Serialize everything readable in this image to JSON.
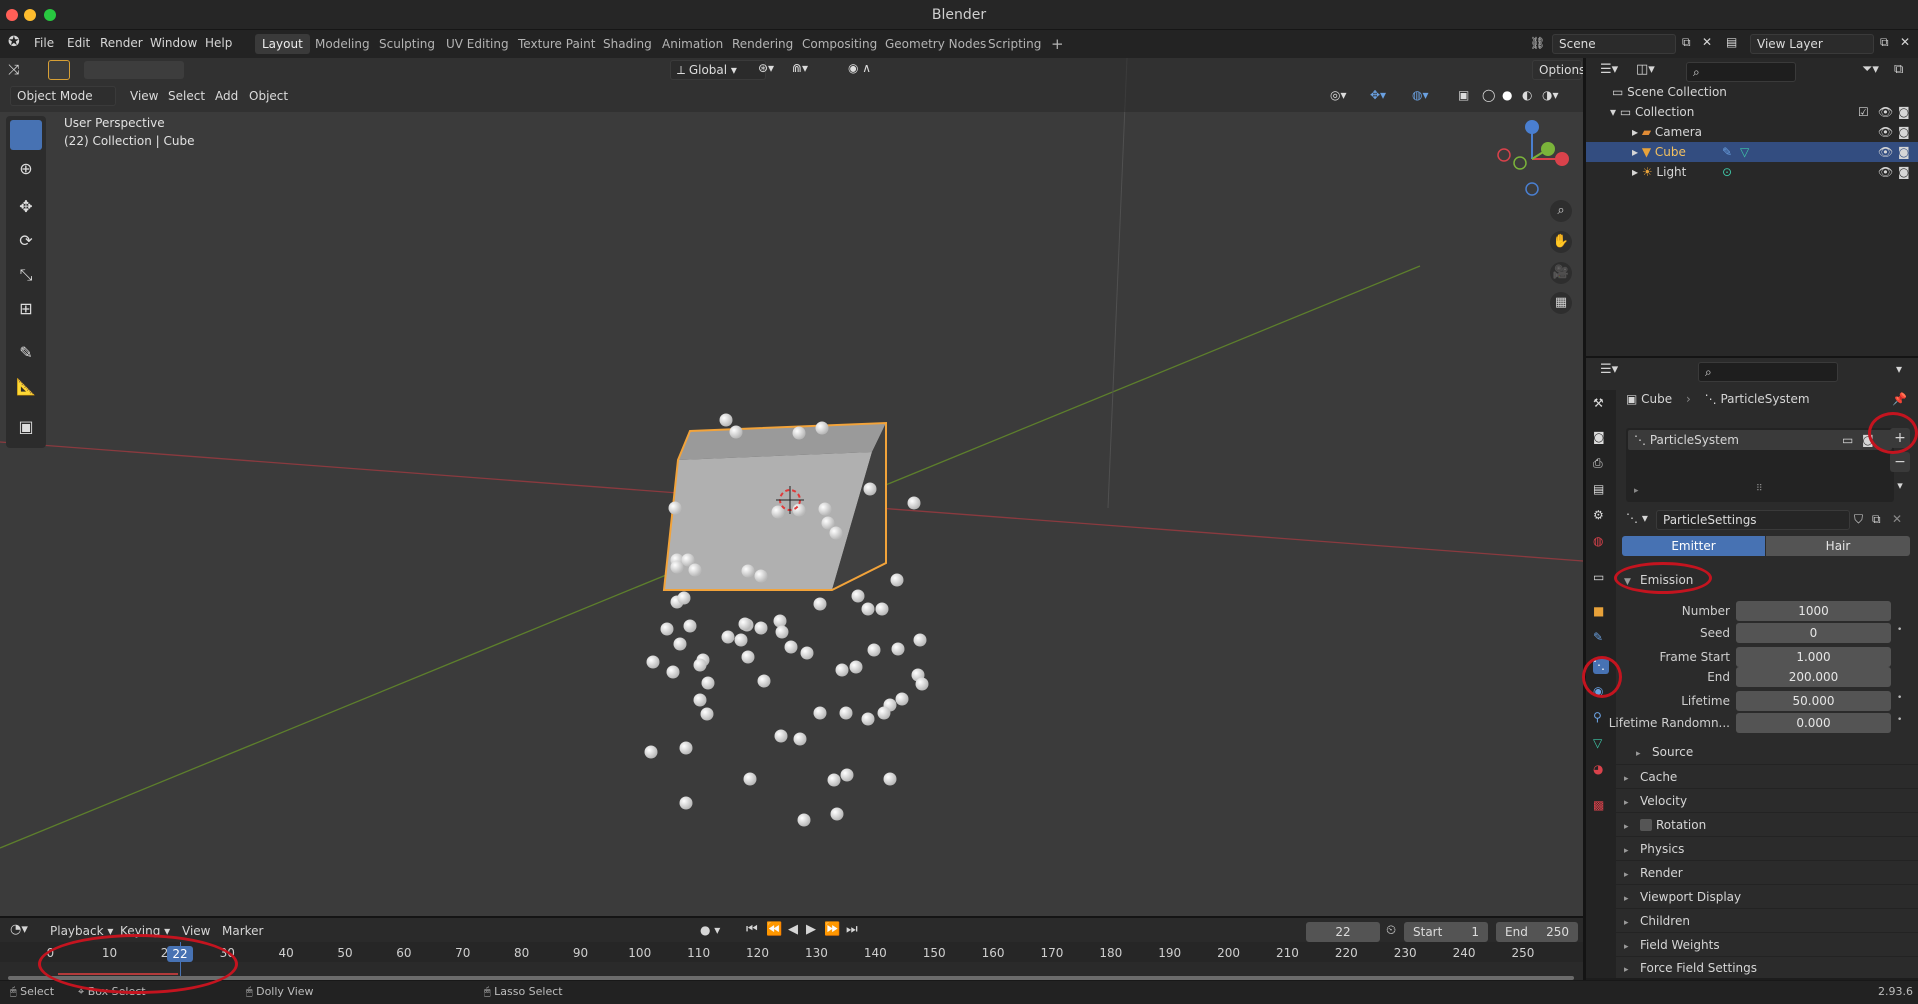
{
  "window": {
    "title": "Blender"
  },
  "menu": {
    "items": [
      "File",
      "Edit",
      "Render",
      "Window",
      "Help"
    ]
  },
  "workspaces": [
    "Layout",
    "Modeling",
    "Sculpting",
    "UV Editing",
    "Texture Paint",
    "Shading",
    "Animation",
    "Rendering",
    "Compositing",
    "Geometry Nodes",
    "Scripting"
  ],
  "active_workspace": "Layout",
  "scene": {
    "name": "Scene",
    "view_layer": "View Layer"
  },
  "viewport_header": {
    "mode": "Object Mode",
    "menus": [
      "View",
      "Select",
      "Add",
      "Object"
    ],
    "transform_orientation": "Global",
    "options_label": "Options"
  },
  "viewport": {
    "perspective_label": "User Perspective",
    "collection_label": "(22) Collection | Cube"
  },
  "outliner": {
    "root": "Scene Collection",
    "collection": "Collection",
    "objects": [
      {
        "name": "Camera",
        "icon": "camera-icon",
        "color": "#e08b35"
      },
      {
        "name": "Cube",
        "icon": "mesh-icon",
        "color": "#e8a23a",
        "selected": true
      },
      {
        "name": "Light",
        "icon": "light-icon",
        "color": "#e8a23a"
      }
    ]
  },
  "properties": {
    "breadcrumb": {
      "object": "Cube",
      "system": "ParticleSystem"
    },
    "particle_list": [
      "ParticleSystem"
    ],
    "settings_name": "ParticleSettings",
    "type_toggle": {
      "emitter": "Emitter",
      "hair": "Hair",
      "active": "Emitter"
    },
    "emission": {
      "title": "Emission",
      "fields": [
        {
          "label": "Number",
          "value": "1000"
        },
        {
          "label": "Seed",
          "value": "0"
        },
        {
          "label": "Frame Start",
          "value": "1.000"
        },
        {
          "label": "End",
          "value": "200.000"
        },
        {
          "label": "Lifetime",
          "value": "50.000"
        },
        {
          "label": "Lifetime Randomn...",
          "value": "0.000"
        }
      ],
      "source": "Source"
    },
    "panels": [
      "Cache",
      "Velocity",
      "Rotation",
      "Physics",
      "Render",
      "Viewport Display",
      "Children",
      "Field Weights",
      "Force Field Settings"
    ]
  },
  "timeline": {
    "menus": [
      "Playback",
      "Keying",
      "View",
      "Marker"
    ],
    "current_frame": "22",
    "start_label": "Start",
    "start": "1",
    "end_label": "End",
    "end": "250",
    "ticks": [
      "0",
      "10",
      "20",
      "30",
      "40",
      "50",
      "60",
      "70",
      "80",
      "90",
      "100",
      "110",
      "120",
      "130",
      "140",
      "150",
      "160",
      "170",
      "180",
      "190",
      "200",
      "210",
      "220",
      "230",
      "240",
      "250"
    ]
  },
  "statusbar": {
    "select": "Select",
    "box_select": "Box Select",
    "dolly_view": "Dolly View",
    "lasso_select": "Lasso Select",
    "version": "2.93.6"
  },
  "colors": {
    "accent": "#4772b3",
    "selected_outline": "#f2a33a",
    "annotation_red": "#c4141f",
    "x_axis": "#a1383f",
    "y_axis": "#5c8a2a"
  }
}
